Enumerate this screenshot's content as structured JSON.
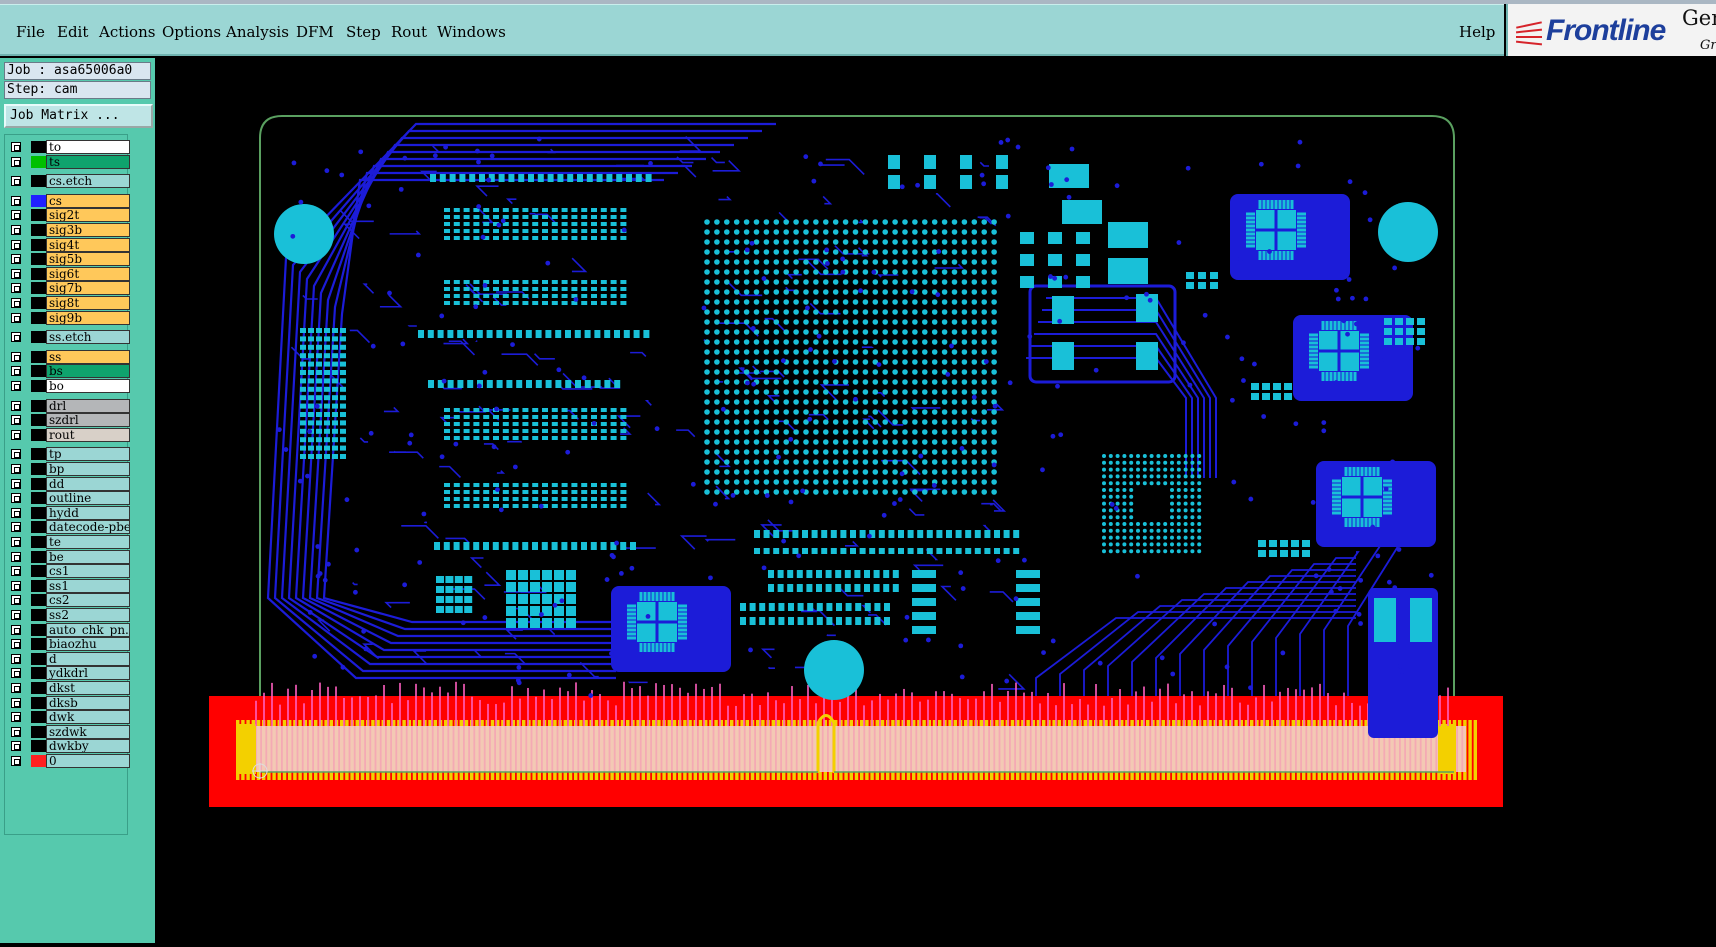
{
  "menubar": {
    "items": [
      "File",
      "Edit",
      "Actions",
      "Options",
      "Analysis",
      "DFM",
      "Step",
      "Rout",
      "Windows"
    ],
    "help": "Help"
  },
  "brand": {
    "logo": "Frontline",
    "tag": "Gen",
    "tag2": "Gr"
  },
  "job": {
    "job_label": "Job : asa65006a0",
    "step_label": "Step: cam",
    "matrix_button": "Job Matrix ..."
  },
  "layers": [
    {
      "name": "to",
      "color": "#ffffff",
      "swatch": "#000000"
    },
    {
      "name": "ts",
      "color": "#0fa36d",
      "swatch": "#00c000"
    },
    {
      "name": "cs.etch",
      "color": "#9bd6d4",
      "swatch": "#000000"
    },
    {
      "name": "cs",
      "color": "#ffc85a",
      "swatch": "#2020ff"
    },
    {
      "name": "sig2t",
      "color": "#ffc85a",
      "swatch": "#000000"
    },
    {
      "name": "sig3b",
      "color": "#ffc85a",
      "swatch": "#000000"
    },
    {
      "name": "sig4t",
      "color": "#ffc85a",
      "swatch": "#000000"
    },
    {
      "name": "sig5b",
      "color": "#ffc85a",
      "swatch": "#000000"
    },
    {
      "name": "sig6t",
      "color": "#ffc85a",
      "swatch": "#000000"
    },
    {
      "name": "sig7b",
      "color": "#ffc85a",
      "swatch": "#000000"
    },
    {
      "name": "sig8t",
      "color": "#ffc85a",
      "swatch": "#000000"
    },
    {
      "name": "sig9b",
      "color": "#ffc85a",
      "swatch": "#000000"
    },
    {
      "name": "ss.etch",
      "color": "#9bd6d4",
      "swatch": "#000000"
    },
    {
      "name": "ss",
      "color": "#ffc85a",
      "swatch": "#000000"
    },
    {
      "name": "bs",
      "color": "#0fa36d",
      "swatch": "#000000"
    },
    {
      "name": "bo",
      "color": "#ffffff",
      "swatch": "#000000"
    },
    {
      "name": "drl",
      "color": "#b4b6b8",
      "swatch": "#000000"
    },
    {
      "name": "szdrl",
      "color": "#b4b6b8",
      "swatch": "#000000"
    },
    {
      "name": "rout",
      "color": "#d8d0c8",
      "swatch": "#000000"
    },
    {
      "name": "tp",
      "color": "#9bd6d4",
      "swatch": "#000000"
    },
    {
      "name": "bp",
      "color": "#9bd6d4",
      "swatch": "#000000"
    },
    {
      "name": "dd",
      "color": "#9bd6d4",
      "swatch": "#000000"
    },
    {
      "name": "outline",
      "color": "#9bd6d4",
      "swatch": "#000000"
    },
    {
      "name": "hydd",
      "color": "#9bd6d4",
      "swatch": "#000000"
    },
    {
      "name": "datecode-pbe",
      "color": "#9bd6d4",
      "swatch": "#000000"
    },
    {
      "name": "te",
      "color": "#9bd6d4",
      "swatch": "#000000"
    },
    {
      "name": "be",
      "color": "#9bd6d4",
      "swatch": "#000000"
    },
    {
      "name": "cs1",
      "color": "#9bd6d4",
      "swatch": "#000000"
    },
    {
      "name": "ss1",
      "color": "#9bd6d4",
      "swatch": "#000000"
    },
    {
      "name": "cs2",
      "color": "#9bd6d4",
      "swatch": "#000000"
    },
    {
      "name": "ss2",
      "color": "#9bd6d4",
      "swatch": "#000000"
    },
    {
      "name": "auto_chk_pn.",
      "color": "#9bd6d4",
      "swatch": "#000000"
    },
    {
      "name": "biaozhu",
      "color": "#9bd6d4",
      "swatch": "#000000"
    },
    {
      "name": "d",
      "color": "#9bd6d4",
      "swatch": "#000000"
    },
    {
      "name": "ydkdrl",
      "color": "#9bd6d4",
      "swatch": "#000000"
    },
    {
      "name": "dkst",
      "color": "#9bd6d4",
      "swatch": "#000000"
    },
    {
      "name": "dksb",
      "color": "#9bd6d4",
      "swatch": "#000000"
    },
    {
      "name": "dwk",
      "color": "#9bd6d4",
      "swatch": "#000000"
    },
    {
      "name": "szdwk",
      "color": "#9bd6d4",
      "swatch": "#000000"
    },
    {
      "name": "dwkby",
      "color": "#9bd6d4",
      "swatch": "#000000"
    },
    {
      "name": "0",
      "color": "#9bd6d4",
      "swatch": "#ff2020"
    }
  ],
  "colors": {
    "trace": "#1c1cd8",
    "pad": "#19c0d8",
    "outline": "#5aa060",
    "keepout": "#ff0000",
    "gold": "#f3d000"
  }
}
